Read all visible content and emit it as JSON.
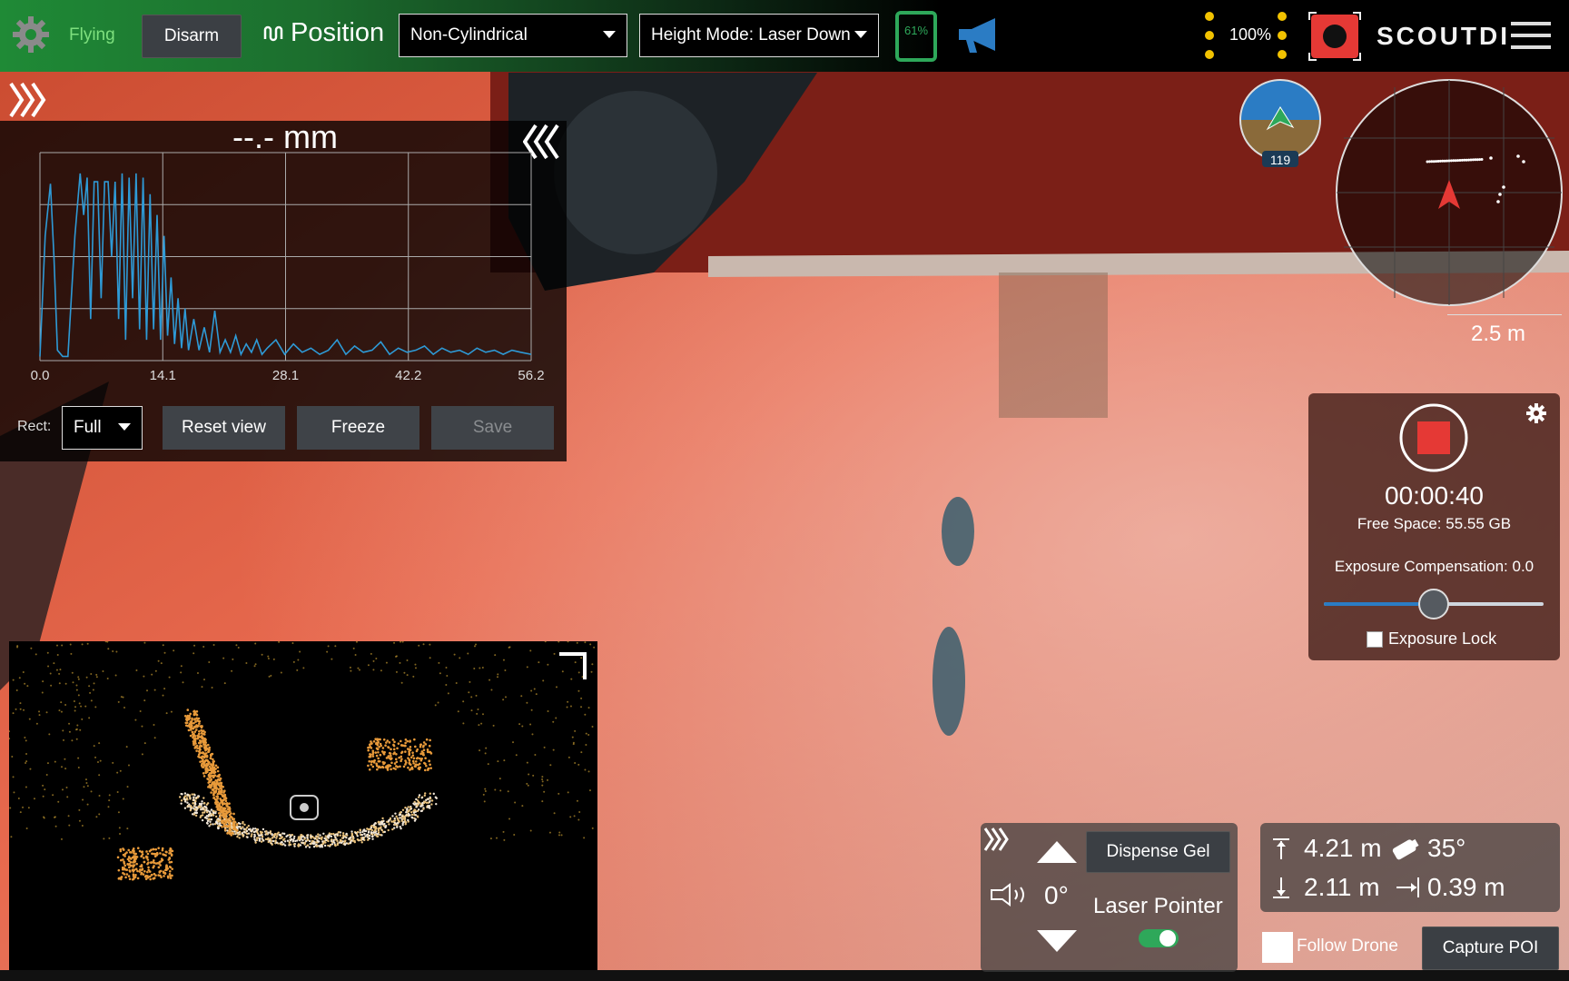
{
  "topbar": {
    "status": "Flying",
    "disarm_label": "Disarm",
    "mode_label": "Position",
    "mode_select": "Non-Cylindrical",
    "height_select": "Height Mode: Laser Down",
    "phone_battery": "61%",
    "brightness": "100%",
    "logo": "SCOUTDI",
    "icons": [
      "gear-icon",
      "phone-battery-icon",
      "megaphone-icon",
      "brightness-icon",
      "record-icon",
      "menu-icon"
    ]
  },
  "profile": {
    "value": "--.- mm",
    "rect_label": "Rect:",
    "rect_select": "Full",
    "reset_label": "Reset view",
    "freeze_label": "Freeze",
    "save_label": "Save"
  },
  "chart_data": {
    "type": "line",
    "x_ticks": [
      "0.0",
      "14.1",
      "28.1",
      "42.2",
      "56.2"
    ],
    "xlim": [
      0,
      56.2
    ],
    "ylim": [
      0,
      1
    ],
    "grid": true,
    "series": [
      {
        "color": "#2e9ad6",
        "x": [
          0.0,
          0.6,
          1.2,
          1.6,
          2.0,
          2.6,
          3.2,
          4.0,
          4.6,
          5.0,
          5.4,
          5.8,
          6.2,
          6.6,
          7.0,
          7.4,
          7.8,
          8.2,
          8.6,
          9.0,
          9.4,
          9.8,
          10.2,
          10.6,
          11.0,
          11.4,
          11.8,
          12.2,
          12.6,
          13.0,
          13.4,
          13.8,
          14.2,
          14.6,
          15.0,
          15.4,
          15.8,
          16.2,
          16.6,
          17.0,
          17.6,
          18.2,
          18.8,
          19.4,
          20.0,
          20.6,
          21.2,
          21.8,
          22.4,
          23.0,
          23.6,
          24.2,
          24.8,
          25.4,
          26.0,
          27.0,
          28.0,
          29.0,
          30.0,
          31.0,
          32.0,
          33.0,
          34.0,
          35.0,
          36.0,
          37.0,
          38.0,
          39.0,
          40.0,
          41.0,
          42.0,
          43.0,
          44.0,
          45.0,
          46.0,
          47.0,
          48.0,
          49.0,
          50.0,
          51.0,
          52.0,
          53.0,
          54.0,
          55.0,
          56.2
        ],
        "y": [
          0.02,
          0.6,
          0.85,
          0.5,
          0.05,
          0.02,
          0.02,
          0.6,
          0.9,
          0.7,
          0.88,
          0.2,
          0.86,
          0.86,
          0.3,
          0.86,
          0.86,
          0.5,
          0.86,
          0.2,
          0.9,
          0.1,
          0.88,
          0.3,
          0.9,
          0.15,
          0.88,
          0.1,
          0.8,
          0.15,
          0.7,
          0.1,
          0.6,
          0.12,
          0.4,
          0.08,
          0.3,
          0.06,
          0.25,
          0.05,
          0.2,
          0.05,
          0.16,
          0.04,
          0.24,
          0.04,
          0.1,
          0.04,
          0.12,
          0.03,
          0.08,
          0.04,
          0.1,
          0.03,
          0.06,
          0.1,
          0.03,
          0.08,
          0.04,
          0.06,
          0.03,
          0.05,
          0.1,
          0.03,
          0.07,
          0.04,
          0.05,
          0.09,
          0.03,
          0.06,
          0.04,
          0.05,
          0.07,
          0.03,
          0.06,
          0.04,
          0.05,
          0.03,
          0.06,
          0.04,
          0.05,
          0.03,
          0.05,
          0.04,
          0.03
        ]
      }
    ]
  },
  "minimap": {
    "scale": "2.5 m"
  },
  "attitude": {
    "heading": "119"
  },
  "recording": {
    "time": "00:00:40",
    "free_space": "Free Space: 55.55 GB",
    "exposure_label": "Exposure Compensation: 0.0",
    "exposure_value": 0.5,
    "lock_label": "Exposure Lock"
  },
  "payload": {
    "angle": "0°",
    "dispense_label": "Dispense Gel",
    "laser_label": "Laser Pointer",
    "laser_on": true
  },
  "distances": {
    "up": "4.21 m",
    "angle": "35°",
    "down": "2.11 m",
    "forward": "0.39 m"
  },
  "follow_label": "Follow Drone",
  "capture_label": "Capture POI",
  "colors": {
    "accent_green": "#1f8a36",
    "record_red": "#e53935",
    "line_blue": "#2e9ad6",
    "hull_orange": "#d9553a"
  }
}
